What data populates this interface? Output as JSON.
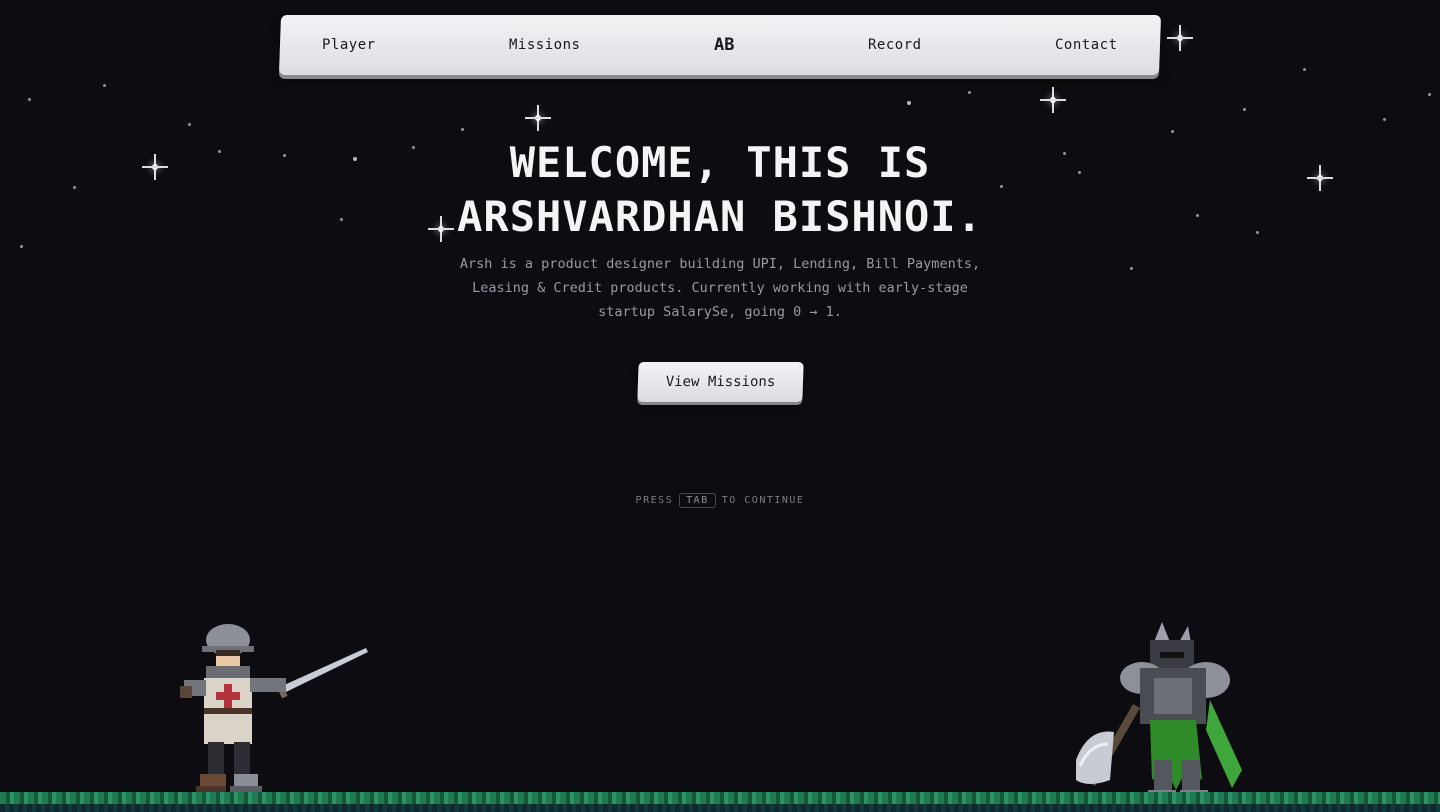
{
  "nav": {
    "items": [
      "Player",
      "Missions",
      "AB",
      "Record",
      "Contact"
    ]
  },
  "hero": {
    "title_line1": "WELCOME, THIS IS",
    "title_line2": "ARSHVARDHAN BISHNOI.",
    "description": "Arsh is a product designer building UPI, Lending, Bill Payments, Leasing & Credit products. Currently working with early-stage startup SalarySe, going 0 → 1.",
    "cta_label": "View Missions"
  },
  "hint": {
    "prefix": "PRESS",
    "key": "TAB",
    "suffix": "TO CONTINUE"
  },
  "colors": {
    "background": "#0d0c10",
    "nav_bg": "#efeef2",
    "ground": "#1f7a52",
    "enemy_accent": "#3ea63a"
  }
}
